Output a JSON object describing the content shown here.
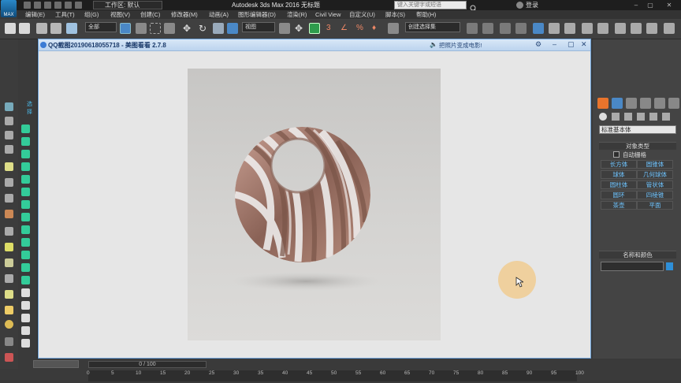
{
  "titlebar": {
    "logo": "MAX",
    "workspace": "工作区: 默认",
    "app_title": "Autodesk 3ds Max 2016      无标题",
    "search_placeholder": "键入关键字或短语",
    "login": "登录"
  },
  "menu": [
    "编辑(E)",
    "工具(T)",
    "组(G)",
    "视图(V)",
    "创建(C)",
    "修改器(M)",
    "动画(A)",
    "图形编辑器(D)",
    "渲染(R)",
    "Civil View",
    "自定义(U)",
    "脚本(S)",
    "帮助(H)"
  ],
  "toolbar": {
    "selection_filter": "全部",
    "view_dropdown": "视图",
    "named_selection": "创建选择集"
  },
  "left_panel": {
    "label": "选择"
  },
  "viewer": {
    "title": "QQ截图20190618055718 - 美图看看 2.7.8",
    "hint": "把照片变成电影!",
    "photo_subject": "twisted-metal-torus"
  },
  "command_panel": {
    "category": "标准基本体",
    "object_type_header": "对象类型",
    "autogrid_label": "自动栅格",
    "buttons": [
      "长方体",
      "圆锥体",
      "球体",
      "几何球体",
      "圆柱体",
      "管状体",
      "圆环",
      "四棱锥",
      "茶壶",
      "平面"
    ],
    "name_color_header": "名称和颜色",
    "color_swatch": "#2e8fd8"
  },
  "timeline": {
    "frame_display": "0 / 100",
    "ticks": [
      "0",
      "5",
      "10",
      "15",
      "20",
      "25",
      "30",
      "35",
      "40",
      "45",
      "50",
      "55",
      "60",
      "65",
      "70",
      "75",
      "80",
      "85",
      "90",
      "95",
      "100"
    ]
  },
  "colors": {
    "accent": "#2e8fd8",
    "button_text": "#6fc4ff",
    "viewer_frame": "#6aa0d8"
  }
}
